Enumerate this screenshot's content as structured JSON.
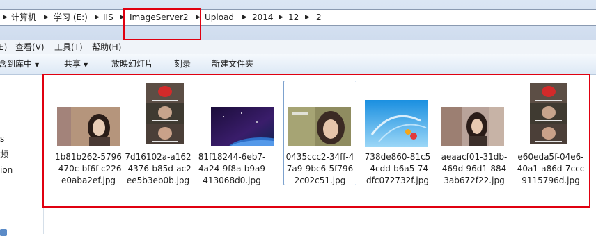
{
  "breadcrumb": {
    "items": [
      "计算机",
      "学习 (E:)",
      "IIS",
      "ImageServer2",
      "Upload",
      "2014",
      "12",
      "2"
    ]
  },
  "menubar": {
    "items": [
      "查看(V)",
      "工具(T)",
      "帮助(H)"
    ],
    "partial_first": "E)"
  },
  "toolbar": {
    "include_library": "含到库中",
    "share": "共享",
    "slideshow": "放映幻灯片",
    "burn": "刻录",
    "new_folder": "新建文件夹"
  },
  "nav": {
    "items": [
      "s",
      "频",
      "ion"
    ]
  },
  "files": [
    {
      "name": "1b81b262-5796\n-470c-bf6f-c226\ne0aba2ef.jpg",
      "thumb": "girl-portrait"
    },
    {
      "name": "7d16102a-a162\n-4376-b85d-ac2\nee5b3eb0b.jpg",
      "thumb": "meme-comic"
    },
    {
      "name": "81f18244-6eb7-\n4a24-9f8a-b9a9\n413068d0.jpg",
      "thumb": "space-planet"
    },
    {
      "name": "0435ccc2-34ff-4\n7a9-9bc6-5f796\n2c02c51.jpg",
      "thumb": "girl-portrait"
    },
    {
      "name": "738de860-81c5\n-4cdd-b6a5-74\ndfc072732f.jpg",
      "thumb": "blue-abstract"
    },
    {
      "name": "aeaacf01-31db-\n469d-96d1-884\n3ab672f22.jpg",
      "thumb": "girl-street"
    },
    {
      "name": "e60eda5f-04e6-\n40a1-a86d-7ccc\n9115796d.jpg",
      "thumb": "meme-comic"
    }
  ],
  "selected_index": 3,
  "highlight_color": "#e00010"
}
